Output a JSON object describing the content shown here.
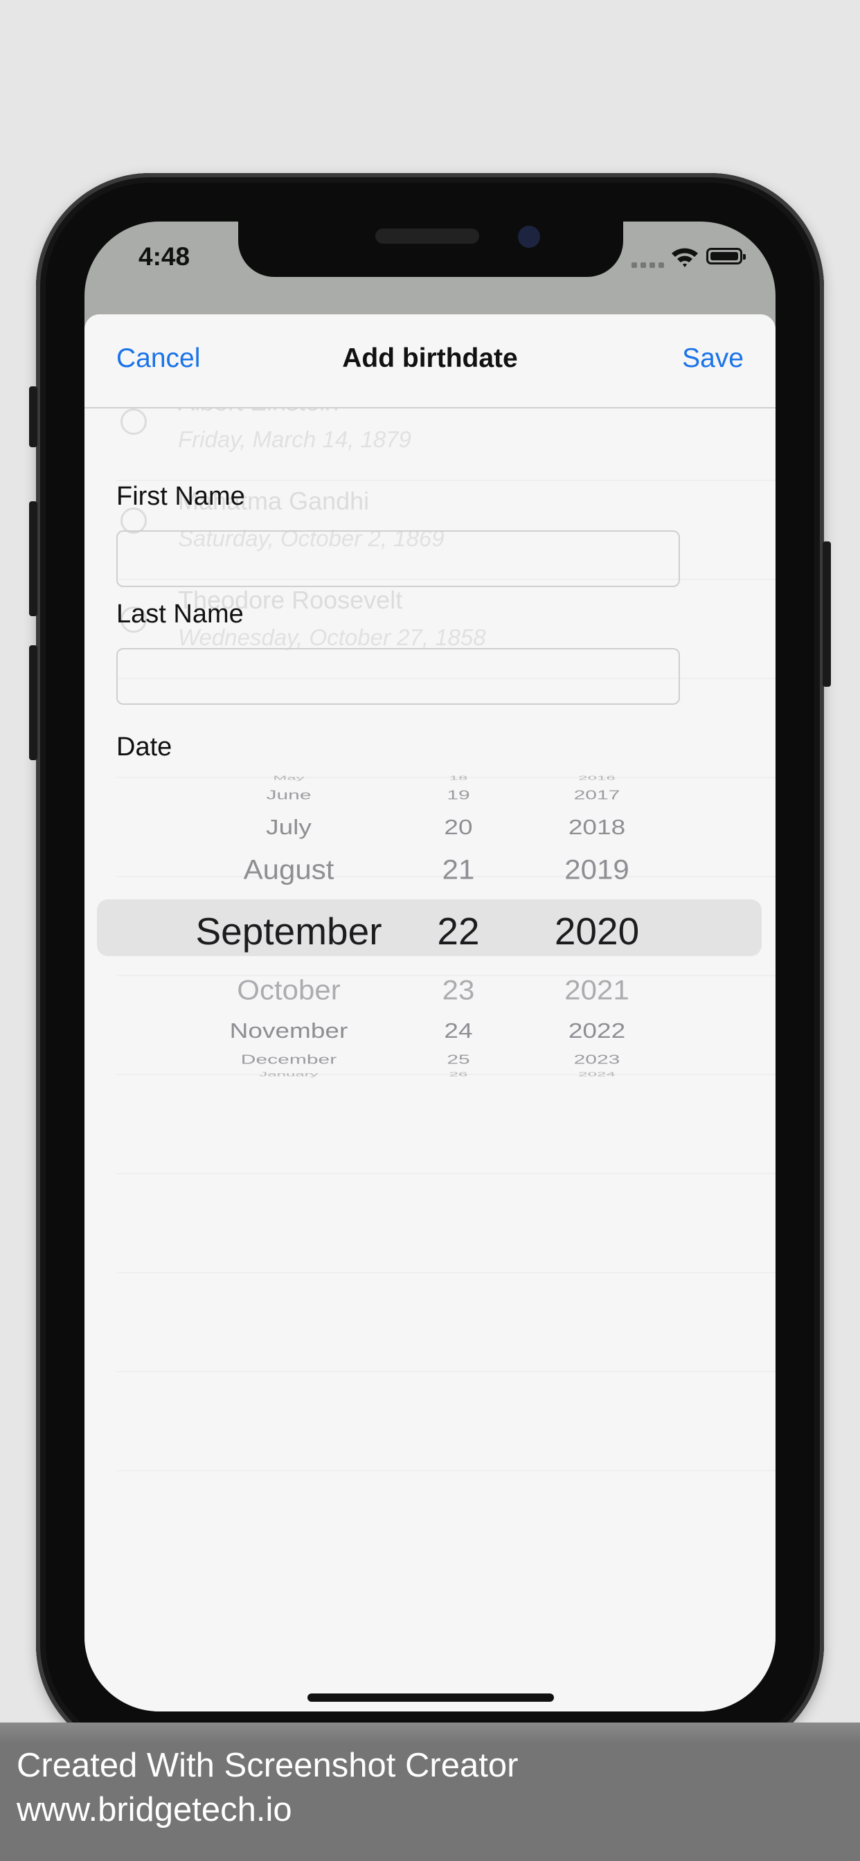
{
  "status_bar": {
    "time": "4:48"
  },
  "nav": {
    "cancel_label": "Cancel",
    "title": "Add birthdate",
    "save_label": "Save"
  },
  "background_list": [
    {
      "name": "Albert Einstein",
      "date": "Friday, March 14, 1879"
    },
    {
      "name": "Mahatma Gandhi",
      "date": "Saturday, October 2, 1869"
    },
    {
      "name": "Theodore Roosevelt",
      "date": "Wednesday, October 27, 1858"
    }
  ],
  "form": {
    "first_name_label": "First Name",
    "first_name_value": "",
    "last_name_label": "Last Name",
    "last_name_value": "",
    "date_label": "Date"
  },
  "picker": {
    "months": [
      "May",
      "June",
      "July",
      "August",
      "September",
      "October",
      "November",
      "December",
      "January"
    ],
    "days": [
      "18",
      "19",
      "20",
      "21",
      "22",
      "23",
      "24",
      "25",
      "26"
    ],
    "years": [
      "2016",
      "2017",
      "2018",
      "2019",
      "2020",
      "2021",
      "2022",
      "2023",
      "2024"
    ],
    "selected": {
      "month": "September",
      "day": "22",
      "year": "2020"
    }
  },
  "watermark": {
    "line1": "Created With Screenshot Creator",
    "line2": "www.bridgetech.io"
  }
}
